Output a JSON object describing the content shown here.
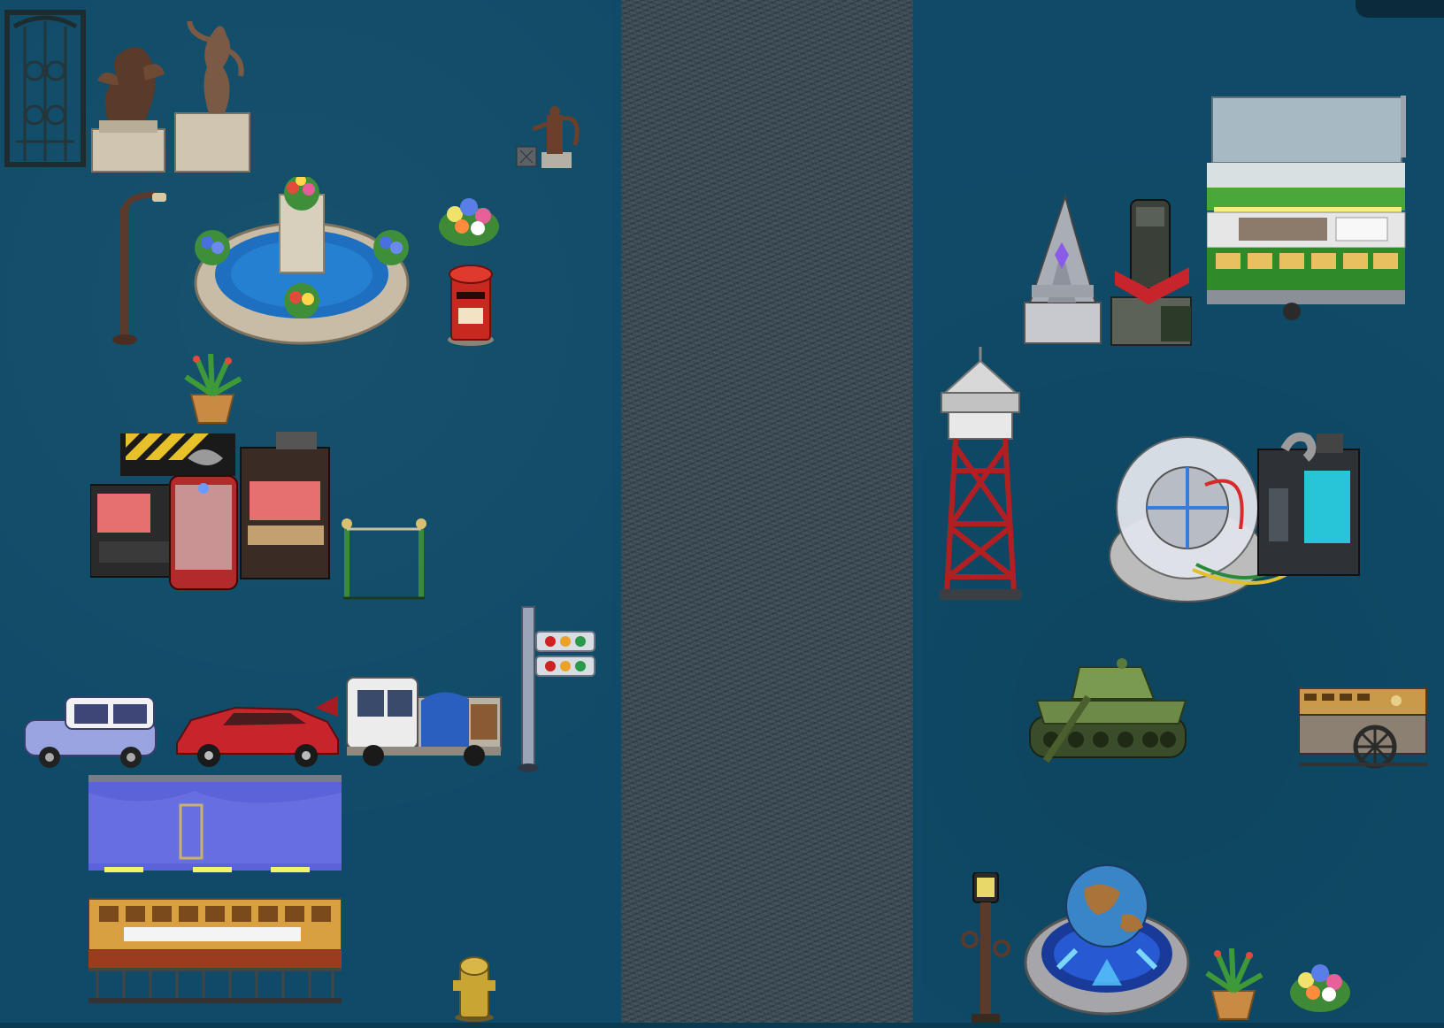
{
  "scene": {
    "kind": "tileset-sprite-sheet",
    "background_color": "#0f4b68",
    "road_color": "#3a4952",
    "sprites": [
      {
        "name": "iron-gate",
        "icon": "gate-icon"
      },
      {
        "name": "bird-statue",
        "icon": "statue-icon"
      },
      {
        "name": "dancer-statue",
        "icon": "statue-icon"
      },
      {
        "name": "water-pump",
        "icon": "pump-icon"
      },
      {
        "name": "street-lamp",
        "icon": "lamp-icon"
      },
      {
        "name": "flower-fountain",
        "icon": "fountain-icon"
      },
      {
        "name": "flower-bunch",
        "icon": "flower-icon"
      },
      {
        "name": "red-mailbox",
        "icon": "mailbox-icon"
      },
      {
        "name": "potted-plant",
        "icon": "plant-icon"
      },
      {
        "name": "machine-console",
        "icon": "machine-icon"
      },
      {
        "name": "rope-barrier",
        "icon": "barrier-icon"
      },
      {
        "name": "lavender-car",
        "icon": "car-icon"
      },
      {
        "name": "red-sports-car",
        "icon": "car-icon"
      },
      {
        "name": "pickup-truck",
        "icon": "truck-icon"
      },
      {
        "name": "traffic-light",
        "icon": "traffic-light-icon"
      },
      {
        "name": "market-stall",
        "icon": "stall-icon"
      },
      {
        "name": "fire-hydrant",
        "icon": "hydrant-icon"
      },
      {
        "name": "crystal-monument",
        "icon": "monument-icon"
      },
      {
        "name": "robot-statue",
        "icon": "robot-icon"
      },
      {
        "name": "food-cart",
        "icon": "cart-icon"
      },
      {
        "name": "water-tower",
        "icon": "tower-icon"
      },
      {
        "name": "dome-reactor",
        "icon": "reactor-icon"
      },
      {
        "name": "army-tank",
        "icon": "tank-icon"
      },
      {
        "name": "wooden-wagon",
        "icon": "wagon-icon"
      },
      {
        "name": "victorian-lamp",
        "icon": "lamp-icon"
      },
      {
        "name": "globe-fountain",
        "icon": "globe-icon"
      },
      {
        "name": "potted-plant-2",
        "icon": "plant-icon"
      },
      {
        "name": "flower-bunch-2",
        "icon": "flower-icon"
      }
    ]
  }
}
